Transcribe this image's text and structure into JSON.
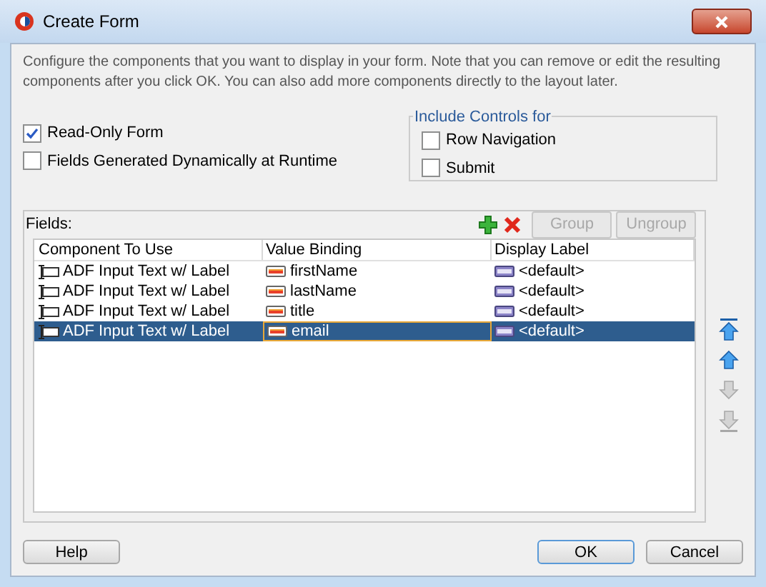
{
  "window": {
    "title": "Create Form"
  },
  "description": "Configure the components that you want to display in your form. Note that you can remove or edit the resulting components after you click OK. You can also add more components directly to the layout later.",
  "options": [
    {
      "label": "Read-Only Form",
      "checked": true
    },
    {
      "label": "Fields Generated Dynamically at Runtime",
      "checked": false
    }
  ],
  "include_controls": {
    "title": "Include Controls for",
    "options": [
      {
        "label": "Row Navigation",
        "checked": false
      },
      {
        "label": "Submit",
        "checked": false
      }
    ]
  },
  "fields": {
    "label": "Fields:",
    "tools": [
      {
        "kind": "add"
      },
      {
        "kind": "delete"
      }
    ],
    "buttons": [
      {
        "label": "Group",
        "disabled": true
      },
      {
        "label": "Ungroup",
        "disabled": true
      }
    ],
    "columns": [
      "Component To Use",
      "Value Binding",
      "Display Label"
    ],
    "rows": [
      {
        "component": "ADF Input Text w/ Label",
        "binding": "firstName",
        "display_label": "<default>",
        "selected": false
      },
      {
        "component": "ADF Input Text w/ Label",
        "binding": "lastName",
        "display_label": "<default>",
        "selected": false
      },
      {
        "component": "ADF Input Text w/ Label",
        "binding": "title",
        "display_label": "<default>",
        "selected": false
      },
      {
        "component": "ADF Input Text w/ Label",
        "binding": "email",
        "display_label": "<default>",
        "selected": true
      }
    ]
  },
  "move_buttons": [
    {
      "kind": "top",
      "disabled": false
    },
    {
      "kind": "up",
      "disabled": false
    },
    {
      "kind": "down",
      "disabled": true
    },
    {
      "kind": "bottom",
      "disabled": true
    }
  ],
  "footer": {
    "left": [
      {
        "label": "Help",
        "default": false
      }
    ],
    "right": [
      {
        "label": "OK",
        "default": true
      },
      {
        "label": "Cancel",
        "default": false
      }
    ]
  }
}
